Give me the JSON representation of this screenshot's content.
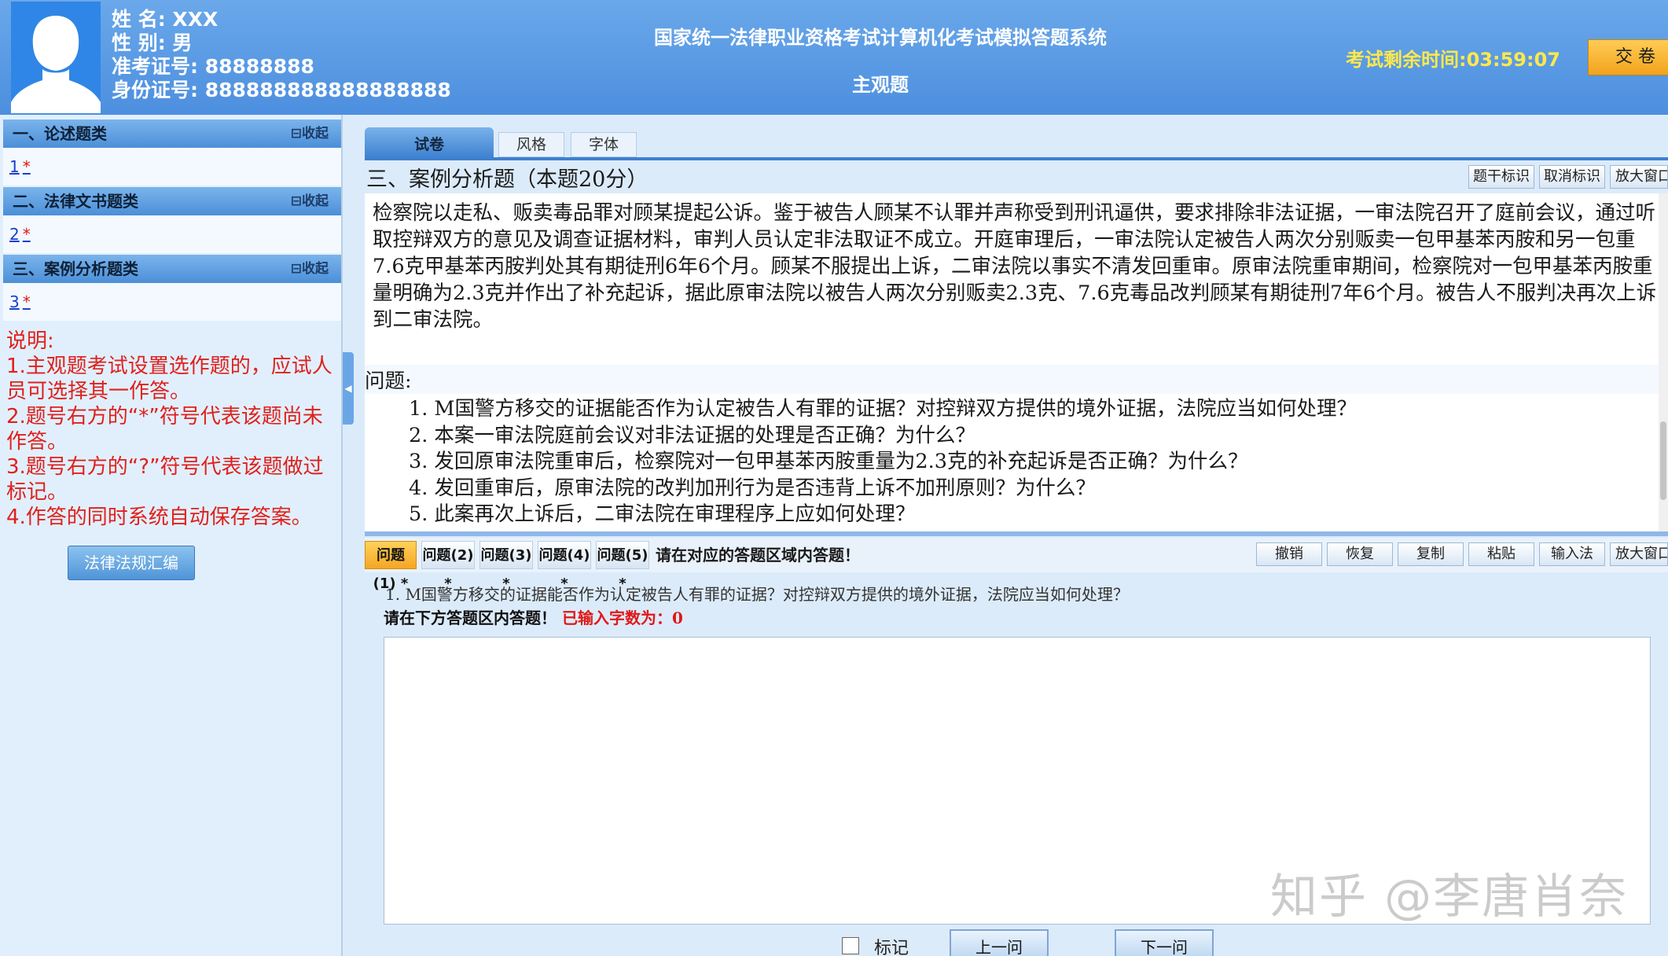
{
  "candidate": {
    "name_label": "姓 名:",
    "name_value": "XXX",
    "gender_label": "性 别:",
    "gender_value": "男",
    "ticket_label": "准考证号:",
    "ticket_value": "88888888",
    "id_label": "身份证号:",
    "id_value": "888888888888888888"
  },
  "header": {
    "system_title": "国家统一法律职业资格考试计算机化考试模拟答题系统",
    "subtitle": "主观题",
    "timer": "考试剩余时间:03:59:07",
    "submit_label": "交 卷"
  },
  "sidebar": {
    "categories": [
      {
        "title": "一、论述题类",
        "collapse": "⊟收起",
        "question": "1",
        "status": "*"
      },
      {
        "title": "二、法律文书题类",
        "collapse": "⊟收起",
        "question": "2",
        "status": "*"
      },
      {
        "title": "三、案例分析题类",
        "collapse": "⊟收起",
        "question": "3",
        "status": "*"
      }
    ],
    "notes": [
      "说明:",
      "1.主观题考试设置选作题的，应试人员可选择其一作答。",
      "2.题号右方的“*”符号代表该题尚未作答。",
      "3.题号右方的“?”符号代表该题做过标记。",
      "4.作答的同时系统自动保存答案。"
    ],
    "law_button": "法律法规汇编"
  },
  "tabs": {
    "paper": "试卷",
    "style": "风格",
    "font": "字体"
  },
  "section": {
    "title": "三、案例分析题（本题20分）",
    "tools": {
      "mark_stem": "题干标识",
      "unmark": "取消标识",
      "zoom": "放大窗口"
    }
  },
  "stem": {
    "text": "检察院以走私、贩卖毒品罪对顾某提起公诉。鉴于被告人顾某不认罪并声称受到刑讯逼供，要求排除非法证据，一审法院召开了庭前会议，通过听取控辩双方的意见及调查证据材料，审判人员认定非法取证不成立。开庭审理后，一审法院认定被告人两次分别贩卖一包甲基苯丙胺和另一包重7.6克甲基苯丙胺判处其有期徒刑6年6个月。顾某不服提出上诉，二审法院以事实不清发回重审。原审法院重审期间，检察院对一包甲基苯丙胺重量明确为2.3克并作出了补充起诉，据此原审法院以被告人两次分别贩卖2.3克、7.6克毒品改判顾某有期徒刑7年6个月。被告人不服判决再次上诉到二审法院。",
    "questions_label": "问题:",
    "questions": [
      "1. M国警方移交的证据能否作为认定被告人有罪的证据？对控辩双方提供的境外证据，法院应当如何处理？",
      "2. 本案一审法院庭前会议对非法证据的处理是否正确？为什么？",
      "3. 发回原审法院重审后，检察院对一包甲基苯丙胺重量为2.3克的补充起诉是否正确？为什么？",
      "4. 发回重审后，原审法院的改判加刑行为是否违背上诉不加刑原则？为什么？",
      "5. 此案再次上诉后，二审法院在审理程序上应如何处理？"
    ]
  },
  "answer": {
    "question_tabs": [
      "问题(1) *",
      "问题(2) *",
      "问题(3) *",
      "问题(4) *",
      "问题(5) *"
    ],
    "hint": "请在对应的答题区域内答题！",
    "tools": {
      "undo": "撤销",
      "redo": "恢复",
      "copy": "复制",
      "paste": "粘贴",
      "ime": "输入法",
      "zoom": "放大窗口"
    },
    "current_question": "1. M国警方移交的证据能否作为认定被告人有罪的证据？对控辩双方提供的境外证据，法院应当如何处理？",
    "prompt": "请在下方答题区内答题！",
    "count_label": "已输入字数为：",
    "count_value": "0",
    "text": ""
  },
  "footer": {
    "mark_label": "标记",
    "prev": "上一问",
    "next": "下一问"
  },
  "watermark": "知乎 @李唐肖奈",
  "colors": {
    "header_bg": "#5a9ae4",
    "timer": "#ffe94a",
    "notes": "#e0201c",
    "active_tab": "#f5a623"
  }
}
